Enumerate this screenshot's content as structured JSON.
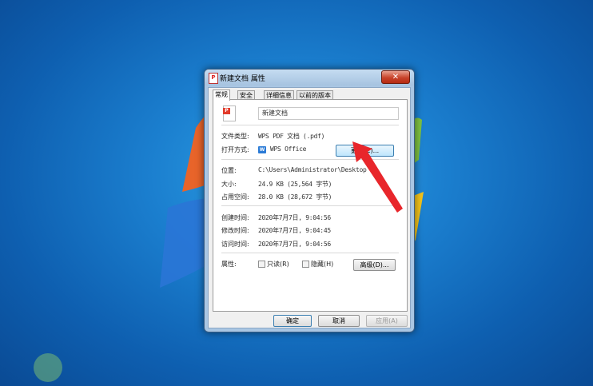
{
  "dialog": {
    "title": "新建文档 属性",
    "close_label": "✕"
  },
  "tabs": [
    {
      "label": "常规"
    },
    {
      "label": "安全"
    },
    {
      "label": "详细信息"
    },
    {
      "label": "以前的版本"
    }
  ],
  "general": {
    "file_name": "新建文档",
    "file_icon_label": "P",
    "file_type_label": "文件类型:",
    "file_type_value": "WPS PDF 文档 (.pdf)",
    "open_with_label": "打开方式:",
    "open_with_value": "WPS Office",
    "open_with_icon_label": "W",
    "change_button": "更改(C)...",
    "location_label": "位置:",
    "location_value": "C:\\Users\\Administrator\\Desktop",
    "size_label": "大小:",
    "size_value": "24.9 KB (25,564 字节)",
    "size_on_disk_label": "占用空间:",
    "size_on_disk_value": "28.0 KB (28,672 字节)",
    "created_label": "创建时间:",
    "created_value": "2020年7月7日, 9:04:56",
    "modified_label": "修改时间:",
    "modified_value": "2020年7月7日, 9:04:45",
    "accessed_label": "访问时间:",
    "accessed_value": "2020年7月7日, 9:04:56",
    "attributes_label": "属性:",
    "readonly_label": "只读(R)",
    "hidden_label": "隐藏(H)",
    "advanced_button": "高级(D)..."
  },
  "footer": {
    "ok": "确定",
    "cancel": "取消",
    "apply": "应用(A)"
  },
  "colors": {
    "desktop": "#1b7fcf",
    "annotation_arrow": "#e8262b"
  }
}
